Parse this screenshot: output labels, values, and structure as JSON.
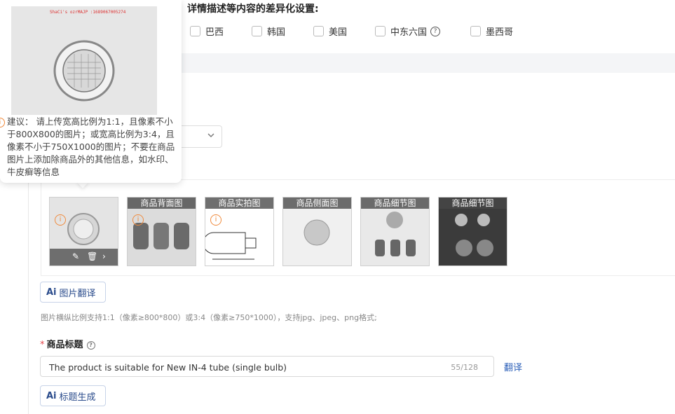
{
  "section": {
    "heading": "详情描述等内容的差异化设置:",
    "countries": [
      {
        "label": "巴西",
        "checked": false
      },
      {
        "label": "韩国",
        "checked": false
      },
      {
        "label": "美国",
        "checked": false
      },
      {
        "label": "中东六国",
        "checked": false,
        "has_help": true
      },
      {
        "label": "墨西哥",
        "checked": false
      }
    ]
  },
  "images": {
    "thumbnails": [
      {
        "caption": "",
        "warning": true,
        "toolbar": true
      },
      {
        "caption": "商品背面图",
        "warning": true
      },
      {
        "caption": "商品实拍图",
        "warning": true
      },
      {
        "caption": "商品侧面图",
        "warning": false
      },
      {
        "caption": "商品细节图",
        "warning": false
      },
      {
        "caption": "商品细节图",
        "warning": false
      }
    ],
    "translate_button": "图片翻译",
    "ai_badge": "Ai",
    "hint": "图片横纵比例支持1:1（像素≥800*800）或3:4（像素≥750*1000），支持jpg、jpeg、png格式;"
  },
  "tooltip": {
    "text": "建议： 请上传宽高比例为1:1，且像素不小于800X800的图片；或宽高比例为3:4，且像素不小于750X1000的图片；不要在商品图片上添加除商品外的其他信息，如水印、牛皮癣等信息",
    "warn_glyph": "i"
  },
  "product_title": {
    "required_mark": "*",
    "label": "商品标题",
    "help_glyph": "?",
    "value": "The product is suitable for New IN-4 tube (single bulb)",
    "counter": "55/128",
    "translate_link": "翻译",
    "generate_button": "标题生成"
  },
  "colors": {
    "accent": "#2b5fb8",
    "warning": "#f08a3c",
    "required": "#e5484d"
  }
}
